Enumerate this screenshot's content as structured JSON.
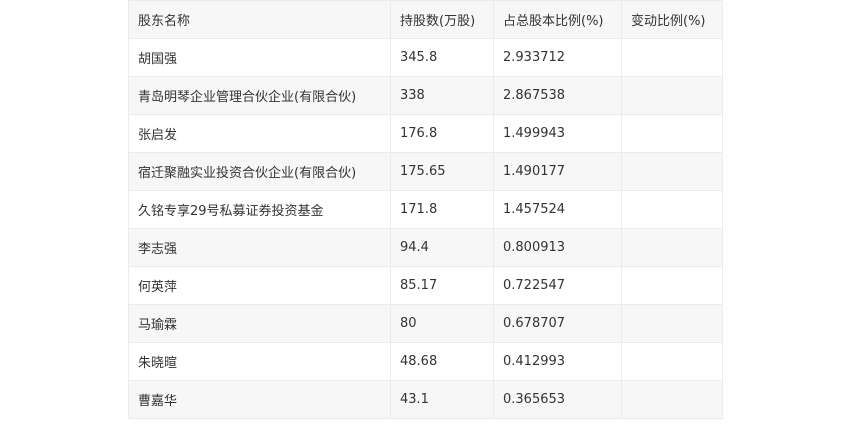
{
  "table": {
    "headers": [
      "股东名称",
      "持股数(万股)",
      "占总股本比例(%)",
      "变动比例(%)"
    ],
    "rows": [
      {
        "name": "胡国强",
        "shares": "345.8",
        "ratio": "2.933712",
        "change": ""
      },
      {
        "name": "青岛明琴企业管理合伙企业(有限合伙)",
        "shares": "338",
        "ratio": "2.867538",
        "change": ""
      },
      {
        "name": "张启发",
        "shares": "176.8",
        "ratio": "1.499943",
        "change": ""
      },
      {
        "name": "宿迁聚融实业投资合伙企业(有限合伙)",
        "shares": "175.65",
        "ratio": "1.490177",
        "change": ""
      },
      {
        "name": "久铭专享29号私募证券投资基金",
        "shares": "171.8",
        "ratio": "1.457524",
        "change": ""
      },
      {
        "name": "李志强",
        "shares": "94.4",
        "ratio": "0.800913",
        "change": ""
      },
      {
        "name": "何英萍",
        "shares": "85.17",
        "ratio": "0.722547",
        "change": ""
      },
      {
        "name": "马瑜霖",
        "shares": "80",
        "ratio": "0.678707",
        "change": ""
      },
      {
        "name": "朱晓暄",
        "shares": "48.68",
        "ratio": "0.412993",
        "change": ""
      },
      {
        "name": "曹嘉华",
        "shares": "43.1",
        "ratio": "0.365653",
        "change": ""
      }
    ]
  },
  "colors": {
    "header_bg": "#f7f7f7",
    "stripe_bg": "#f7f7f7",
    "border": "#ebebeb",
    "text": "#333333"
  }
}
